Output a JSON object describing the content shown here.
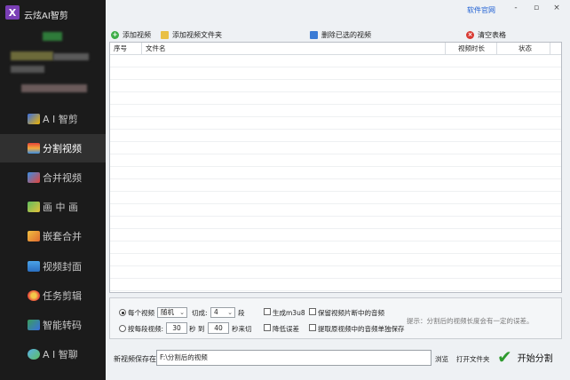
{
  "app": {
    "title": "云炫AI智剪",
    "logo_letter": "X"
  },
  "window": {
    "link": "软件官网",
    "minimize": "-",
    "maximize": "▫",
    "close": "×"
  },
  "sidebar": {
    "items": [
      {
        "label": "A I 智剪",
        "icon": "ai-cut-icon"
      },
      {
        "label": "分割视频",
        "icon": "split-video-icon"
      },
      {
        "label": "合并视频",
        "icon": "merge-video-icon"
      },
      {
        "label": "画 中 画",
        "icon": "picture-in-picture-icon"
      },
      {
        "label": "嵌套合并",
        "icon": "nested-merge-icon"
      },
      {
        "label": "视频封面",
        "icon": "video-cover-icon"
      },
      {
        "label": "任务剪辑",
        "icon": "task-edit-icon"
      },
      {
        "label": "智能转码",
        "icon": "transcode-icon"
      },
      {
        "label": "A I 智聊",
        "icon": "ai-chat-icon"
      }
    ],
    "active_index": 1
  },
  "toolbar": {
    "add_video": "添加视频",
    "add_folder": "添加视频文件夹",
    "delete_selected": "删除已选的视频",
    "clear_table": "清空表格"
  },
  "table": {
    "columns": [
      "序号",
      "文件名",
      "视频时长",
      "状态"
    ],
    "rows": []
  },
  "options": {
    "per_video_label": "每个视频",
    "mode_value": "随机",
    "cut_label": "切成:",
    "cut_count": "4",
    "segments_label": "段",
    "per_segment_label": "按每段视频:",
    "from_seconds": "30",
    "seconds_to": "秒 到",
    "to_seconds": "40",
    "seconds_cut": "秒来切",
    "generate_m3u8": "生成m3u8",
    "reduce_error": "降低误差",
    "keep_audio": "保留视频片断中的音频",
    "extract_audio": "提取原视频中的音频单独保存",
    "hint": "提示：分割后的视频长度会有一定的误差。"
  },
  "output": {
    "save_label": "新视频保存在:",
    "save_path": "F:\\分割后的视频",
    "browse": "浏览",
    "open_folder": "打开文件夹",
    "start": "开始分割"
  },
  "colors": {
    "accent_link": "#1d5fd3",
    "start_check": "#2e9a2e",
    "sidebar_bg": "#1b1b1b",
    "sidebar_active": "#303030"
  }
}
